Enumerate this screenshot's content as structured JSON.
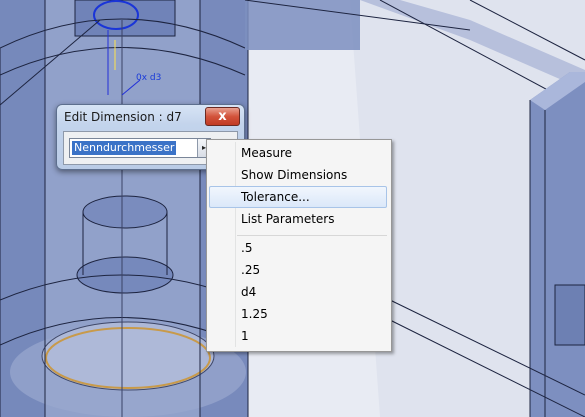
{
  "dialog": {
    "title": "Edit Dimension : d7",
    "close_label": "x",
    "value": "Nenndurchmesser",
    "dropdown_icon": "triangle-right-arrow"
  },
  "viewport": {
    "annotation": "0x d3"
  },
  "context_menu": {
    "commands": [
      "Measure",
      "Show Dimensions",
      "Tolerance...",
      "List Parameters"
    ],
    "highlighted": "Tolerance...",
    "recent_values": [
      ".5",
      ".25",
      "d4",
      "1.25",
      "1"
    ]
  },
  "colors": {
    "model_fill": "#7d8fbf",
    "highlight": "#dbe8f9",
    "close_button": "#c8452f",
    "selection": "#3b73c7"
  }
}
